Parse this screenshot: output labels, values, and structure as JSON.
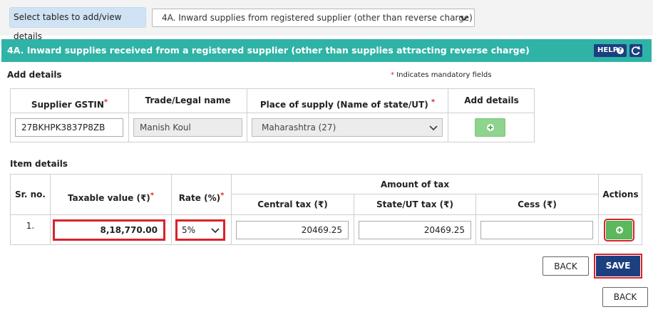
{
  "selector": {
    "label": "Select tables to add/view details",
    "selected": "4A. Inward supplies from registered supplier (other than reverse charge)"
  },
  "section": {
    "title": "4A. Inward supplies received from a registered supplier (other than supplies attracting reverse charge)",
    "help_label": "HELP"
  },
  "add_details": {
    "title": "Add details",
    "mandatory_note": "Indicates mandatory fields",
    "columns": [
      "Supplier GSTIN",
      "Trade/Legal name",
      "Place of supply (Name of state/UT)",
      "Add details"
    ],
    "gstin": "27BKHPK3837P8ZB",
    "trade_name": "Manish Koul",
    "place_of_supply": "Maharashtra (27)"
  },
  "item_details": {
    "title": "Item details",
    "headers": {
      "sr_no": "Sr. no.",
      "taxable_value": "Taxable value (₹)",
      "rate": "Rate (%)",
      "amount_of_tax": "Amount of tax",
      "central_tax": "Central tax (₹)",
      "state_tax": "State/UT tax (₹)",
      "cess": "Cess (₹)",
      "actions": "Actions"
    },
    "row": {
      "sr_no": "1.",
      "taxable_value": "8,18,770.00",
      "rate": "5%",
      "central_tax": "20469.25",
      "state_tax": "20469.25",
      "cess": ""
    }
  },
  "buttons": {
    "back": "BACK",
    "save": "SAVE"
  },
  "colors": {
    "header_bg": "#2fb3a6",
    "primary": "#1c3f80",
    "add_button": "#8ed38e",
    "highlight": "#d9232c"
  }
}
